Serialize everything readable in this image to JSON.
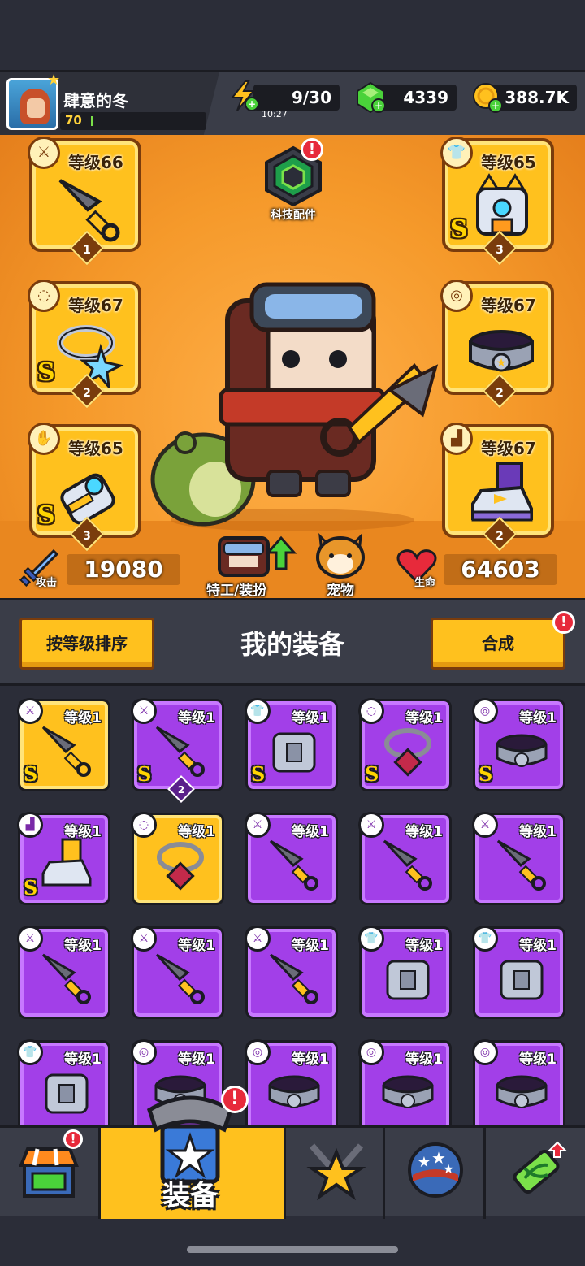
{
  "player": {
    "name": "肆意的冬",
    "level": "70",
    "xp_fraction": 0.02
  },
  "resources": {
    "energy": {
      "value": "9/30",
      "timer": "10:27"
    },
    "gems": {
      "value": "4339"
    },
    "coins": {
      "value": "388.7K"
    }
  },
  "equipped": [
    {
      "slot": "weapon",
      "level": "等级66",
      "count": "1",
      "s_rank": ""
    },
    {
      "slot": "armor",
      "level": "等级65",
      "count": "3",
      "s_rank": "S"
    },
    {
      "slot": "necklace",
      "level": "等级67",
      "count": "2",
      "s_rank": "S"
    },
    {
      "slot": "belt",
      "level": "等级67",
      "count": "2",
      "s_rank": ""
    },
    {
      "slot": "gloves",
      "level": "等级65",
      "count": "3",
      "s_rank": "S"
    },
    {
      "slot": "boots",
      "level": "等级67",
      "count": "2",
      "s_rank": ""
    }
  ],
  "tech": {
    "label": "科技配件",
    "badge": "!"
  },
  "stats": {
    "attack": {
      "label": "攻击",
      "value": "19080"
    },
    "health": {
      "label": "生命",
      "value": "64603"
    }
  },
  "hero_buttons": {
    "agent": "特工/装扮",
    "pet": "宠物"
  },
  "section": {
    "sort_label": "按等级排序",
    "title": "我的装备",
    "merge_label": "合成",
    "merge_badge": "!"
  },
  "inventory": [
    {
      "level": "等级1",
      "tier": "gold",
      "type": "weapon",
      "s": "S",
      "count": ""
    },
    {
      "level": "等级1",
      "tier": "purple",
      "type": "weapon",
      "s": "S",
      "count": "2"
    },
    {
      "level": "等级1",
      "tier": "purple",
      "type": "armor",
      "s": "S",
      "count": ""
    },
    {
      "level": "等级1",
      "tier": "purple",
      "type": "necklace",
      "s": "S",
      "count": ""
    },
    {
      "level": "等级1",
      "tier": "purple",
      "type": "belt",
      "s": "S",
      "count": ""
    },
    {
      "level": "等级1",
      "tier": "purple",
      "type": "boots",
      "s": "S",
      "count": ""
    },
    {
      "level": "等级1",
      "tier": "gold",
      "type": "necklace",
      "s": "",
      "count": ""
    },
    {
      "level": "等级1",
      "tier": "purple",
      "type": "weapon",
      "s": "",
      "count": ""
    },
    {
      "level": "等级1",
      "tier": "purple",
      "type": "weapon",
      "s": "",
      "count": ""
    },
    {
      "level": "等级1",
      "tier": "purple",
      "type": "weapon",
      "s": "",
      "count": ""
    },
    {
      "level": "等级1",
      "tier": "purple",
      "type": "weapon",
      "s": "",
      "count": ""
    },
    {
      "level": "等级1",
      "tier": "purple",
      "type": "weapon",
      "s": "",
      "count": ""
    },
    {
      "level": "等级1",
      "tier": "purple",
      "type": "weapon",
      "s": "",
      "count": ""
    },
    {
      "level": "等级1",
      "tier": "purple",
      "type": "armor",
      "s": "",
      "count": ""
    },
    {
      "level": "等级1",
      "tier": "purple",
      "type": "armor",
      "s": "",
      "count": ""
    },
    {
      "level": "等级1",
      "tier": "purple",
      "type": "armor",
      "s": "",
      "count": ""
    },
    {
      "level": "等级1",
      "tier": "purple",
      "type": "belt",
      "s": "",
      "count": ""
    },
    {
      "level": "等级1",
      "tier": "purple",
      "type": "belt",
      "s": "",
      "count": ""
    },
    {
      "level": "等级1",
      "tier": "purple",
      "type": "belt",
      "s": "",
      "count": ""
    },
    {
      "level": "等级1",
      "tier": "purple",
      "type": "belt",
      "s": "",
      "count": ""
    }
  ],
  "nav": {
    "active_label": "装备",
    "shop_badge": "!",
    "equip_badge": "!"
  },
  "colors": {
    "accent": "#ffc11e",
    "purple_tier": "#a23fe8",
    "alert": "#e72a3b",
    "hero_bg": "#f5992a"
  }
}
